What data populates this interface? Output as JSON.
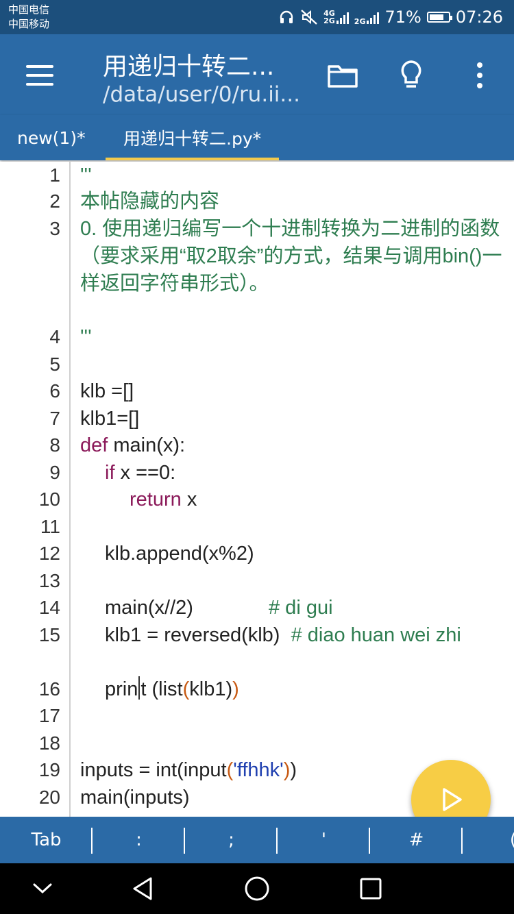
{
  "status_bar": {
    "carrier1": "中国电信",
    "carrier2": "中国移动",
    "net1": "4G",
    "net2": "2G",
    "net3": "2G",
    "battery": "71%",
    "time": "07:26"
  },
  "app_bar": {
    "title": "用递归十转二...",
    "path": "/data/user/0/ru.ii..."
  },
  "tabs": [
    {
      "label": "new(1)*"
    },
    {
      "label": "用递归十转二.py*"
    }
  ],
  "editor": {
    "line_numbers": [
      "1",
      "2",
      "3",
      "4",
      "5",
      "6",
      "7",
      "8",
      "9",
      "10",
      "11",
      "12",
      "13",
      "14",
      "15",
      "16",
      "17",
      "18",
      "19",
      "20"
    ],
    "lines": {
      "l1": "'''",
      "l2": "本帖隐藏的内容",
      "l3": "0. 使用递归编写一个十进制转换为二进制的函数（要求采用“取2取余”的方式，结果与调用bin()一样返回字符串形式）。",
      "l4": "'''",
      "l6": "klb =[]",
      "l7": "klb1=[]",
      "l8_kw": "def",
      "l8_rest": " main(x):",
      "l9_kw": "if",
      "l9_rest": " x ==0:",
      "l10_kw": "return",
      "l10_rest": " x",
      "l12": "klb.append(x%2)",
      "l14_code": "main(x//2)",
      "l14_comment": "# di gui",
      "l15_code": "klb1 = reversed(klb)",
      "l15_comment": "# diao huan wei zhi",
      "l16_a": "prin",
      "l16_b": "t (list",
      "l16_c": "(",
      "l16_d": "klb1)",
      "l16_e": ")",
      "l19_a": "inputs = int(input",
      "l19_b": "(",
      "l19_c": "'ffhhk'",
      "l19_d": ")",
      "l19_e": ")",
      "l20": "main(inputs)"
    }
  },
  "symbol_bar": [
    "Tab",
    ":",
    ";",
    "'",
    "#",
    "("
  ],
  "fab": {
    "icon": "play-icon"
  },
  "colors": {
    "app_bar": "#2b6aa6",
    "status_bar": "#1c4f7c",
    "accent": "#f7cd45",
    "string": "#2e7d50",
    "keyword": "#8b1a5a"
  }
}
